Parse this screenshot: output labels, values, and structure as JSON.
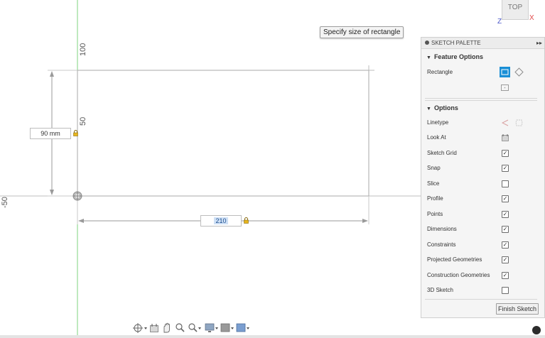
{
  "canvas": {
    "tooltip": "Specify size of rectangle",
    "axis_labels": {
      "top": "100",
      "mid": "50",
      "left": "-50"
    },
    "height_dimension": "90 mm",
    "width_dimension": "210"
  },
  "viewcube": {
    "face": "TOP",
    "axis_z": "Z",
    "axis_x": "X"
  },
  "palette": {
    "title": "SKETCH PALETTE",
    "feature_options": {
      "title": "Feature Options",
      "rectangle_label": "Rectangle"
    },
    "options": {
      "title": "Options",
      "linetype_label": "Linetype",
      "look_at_label": "Look At",
      "items": [
        {
          "label": "Sketch Grid",
          "checked": true
        },
        {
          "label": "Snap",
          "checked": true
        },
        {
          "label": "Slice",
          "checked": false
        },
        {
          "label": "Profile",
          "checked": true
        },
        {
          "label": "Points",
          "checked": true
        },
        {
          "label": "Dimensions",
          "checked": true
        },
        {
          "label": "Constraints",
          "checked": true
        },
        {
          "label": "Projected Geometries",
          "checked": true
        },
        {
          "label": "Construction Geometries",
          "checked": true
        },
        {
          "label": "3D Sketch",
          "checked": false
        }
      ]
    },
    "finish_label": "Finish Sketch"
  },
  "colors": {
    "accent": "#1a8fd6",
    "grid_line": "#d9d9d9",
    "y_axis": "#7ed37e",
    "sketch_line": "#9a9a9a",
    "axis_x": "#e04848",
    "axis_z": "#4b57c8"
  },
  "toolbar": {
    "icons": [
      "orbit-icon",
      "look-at-icon",
      "pan-icon",
      "zoom-icon",
      "zoom-window-icon",
      "display-icon",
      "visual-style-icon",
      "environment-icon"
    ]
  }
}
